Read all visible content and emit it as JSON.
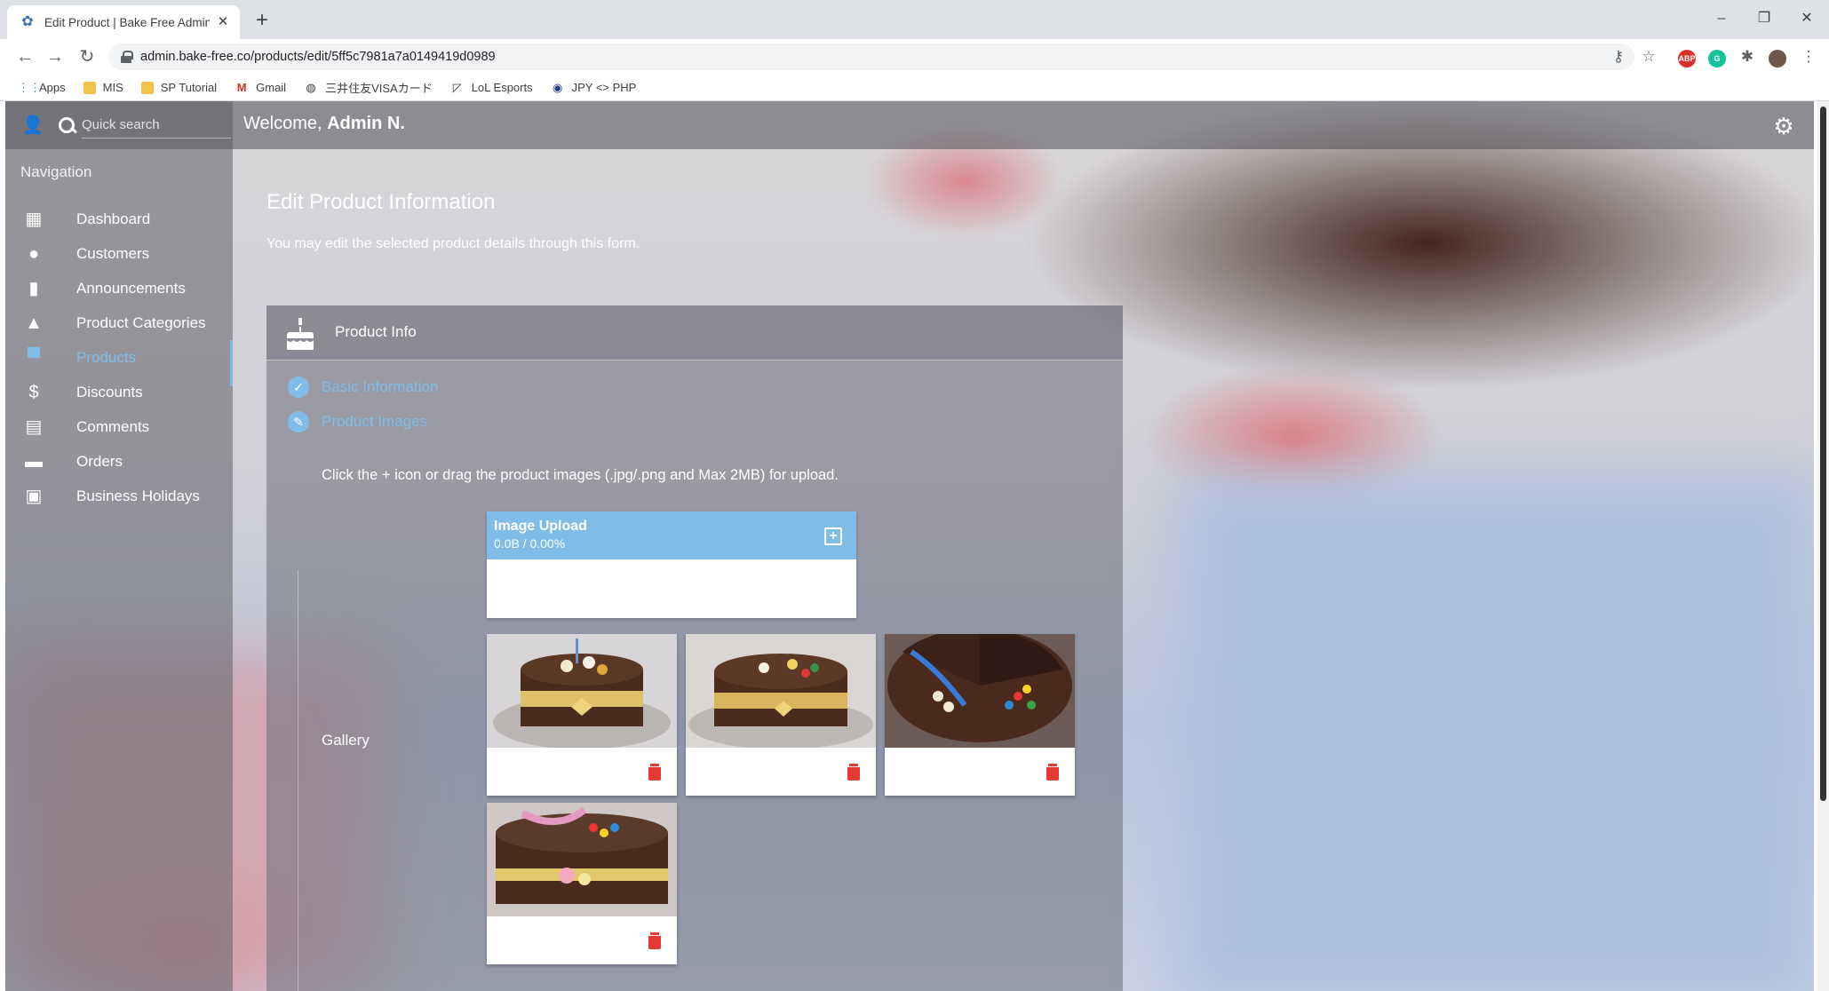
{
  "browser": {
    "tab_title": "Edit Product | Bake Free Admin P",
    "url": "admin.bake-free.co/products/edit/5ff5c7981a7a0149419d0989",
    "bookmarks": [
      {
        "label": "Apps",
        "icon": "apps-grid-icon"
      },
      {
        "label": "MIS",
        "icon": "folder-icon"
      },
      {
        "label": "SP Tutorial",
        "icon": "folder-icon"
      },
      {
        "label": "Gmail",
        "icon": "gmail-icon"
      },
      {
        "label": "三井住友VISAカード",
        "icon": "globe-icon"
      },
      {
        "label": "LoL Esports",
        "icon": "lol-icon"
      },
      {
        "label": "JPY <> PHP",
        "icon": "exchange-icon"
      }
    ]
  },
  "header": {
    "search_placeholder": "Quick search",
    "welcome_prefix": "Welcome, ",
    "welcome_name": "Admin N."
  },
  "sidebar": {
    "title": "Navigation",
    "items": [
      {
        "label": "Dashboard",
        "icon": "dashboard-icon"
      },
      {
        "label": "Customers",
        "icon": "user-circle-icon"
      },
      {
        "label": "Announcements",
        "icon": "announcement-icon"
      },
      {
        "label": "Product Categories",
        "icon": "shapes-icon"
      },
      {
        "label": "Products",
        "icon": "cake-icon",
        "active": true
      },
      {
        "label": "Discounts",
        "icon": "discount-icon"
      },
      {
        "label": "Comments",
        "icon": "comment-icon"
      },
      {
        "label": "Orders",
        "icon": "store-icon"
      },
      {
        "label": "Business Holidays",
        "icon": "calendar-icon"
      }
    ]
  },
  "main": {
    "title": "Edit Product Information",
    "subtitle": "You may edit the selected product details through this form.",
    "card_title": "Product Info",
    "steps": [
      {
        "label": "Basic Information",
        "status": "done"
      },
      {
        "label": "Product Images",
        "status": "editing"
      }
    ],
    "instructions": "Click the + icon or drag the product images (.jpg/.png and Max 2MB) for upload.",
    "upload": {
      "title": "Image Upload",
      "progress": "0.0B / 0.00%"
    },
    "gallery_label": "Gallery",
    "gallery_count": 4
  },
  "colors": {
    "accent": "#7fbde8",
    "delete": "#e53935"
  }
}
